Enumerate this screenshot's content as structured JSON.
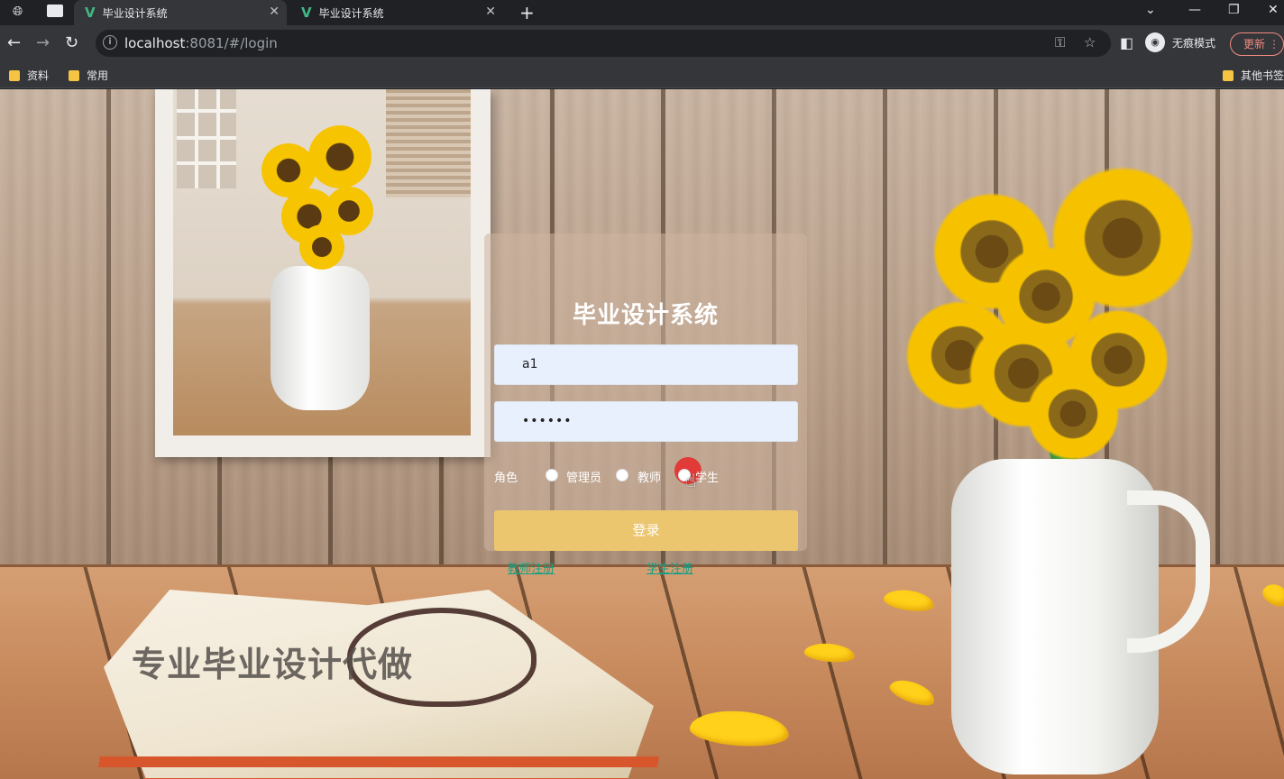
{
  "browser": {
    "tabs": [
      {
        "title": "毕业设计系统",
        "active": true
      },
      {
        "title": "毕业设计系统",
        "active": false
      }
    ],
    "new_tab_symbol": "+",
    "url_host": "localhost",
    "url_rest": ":8081/#/login",
    "incognito_label": "无痕模式",
    "update_label": "更新",
    "bookmarks": [
      "资料",
      "常用"
    ],
    "other_bookmarks": "其他书签"
  },
  "login": {
    "title": "毕业设计系统",
    "username_value": "a1",
    "password_value": "••••••",
    "role_label": "角色",
    "roles": [
      "管理员",
      "教师",
      "学生"
    ],
    "submit_label": "登录",
    "register_links": [
      "教师注册",
      "学生注册"
    ]
  },
  "watermark": "专业毕业设计代做",
  "icons": {
    "back": "arrow-left-icon",
    "forward": "arrow-right-icon",
    "reload": "reload-icon",
    "key": "key-icon",
    "star": "star-icon",
    "sidebar": "sidebar-icon",
    "menu": "kebab-menu-icon"
  },
  "colors": {
    "accent_button": "#ecc66e",
    "link": "#16a085",
    "input_bg": "#e8f0fe",
    "tab_logo": "#41b883"
  }
}
